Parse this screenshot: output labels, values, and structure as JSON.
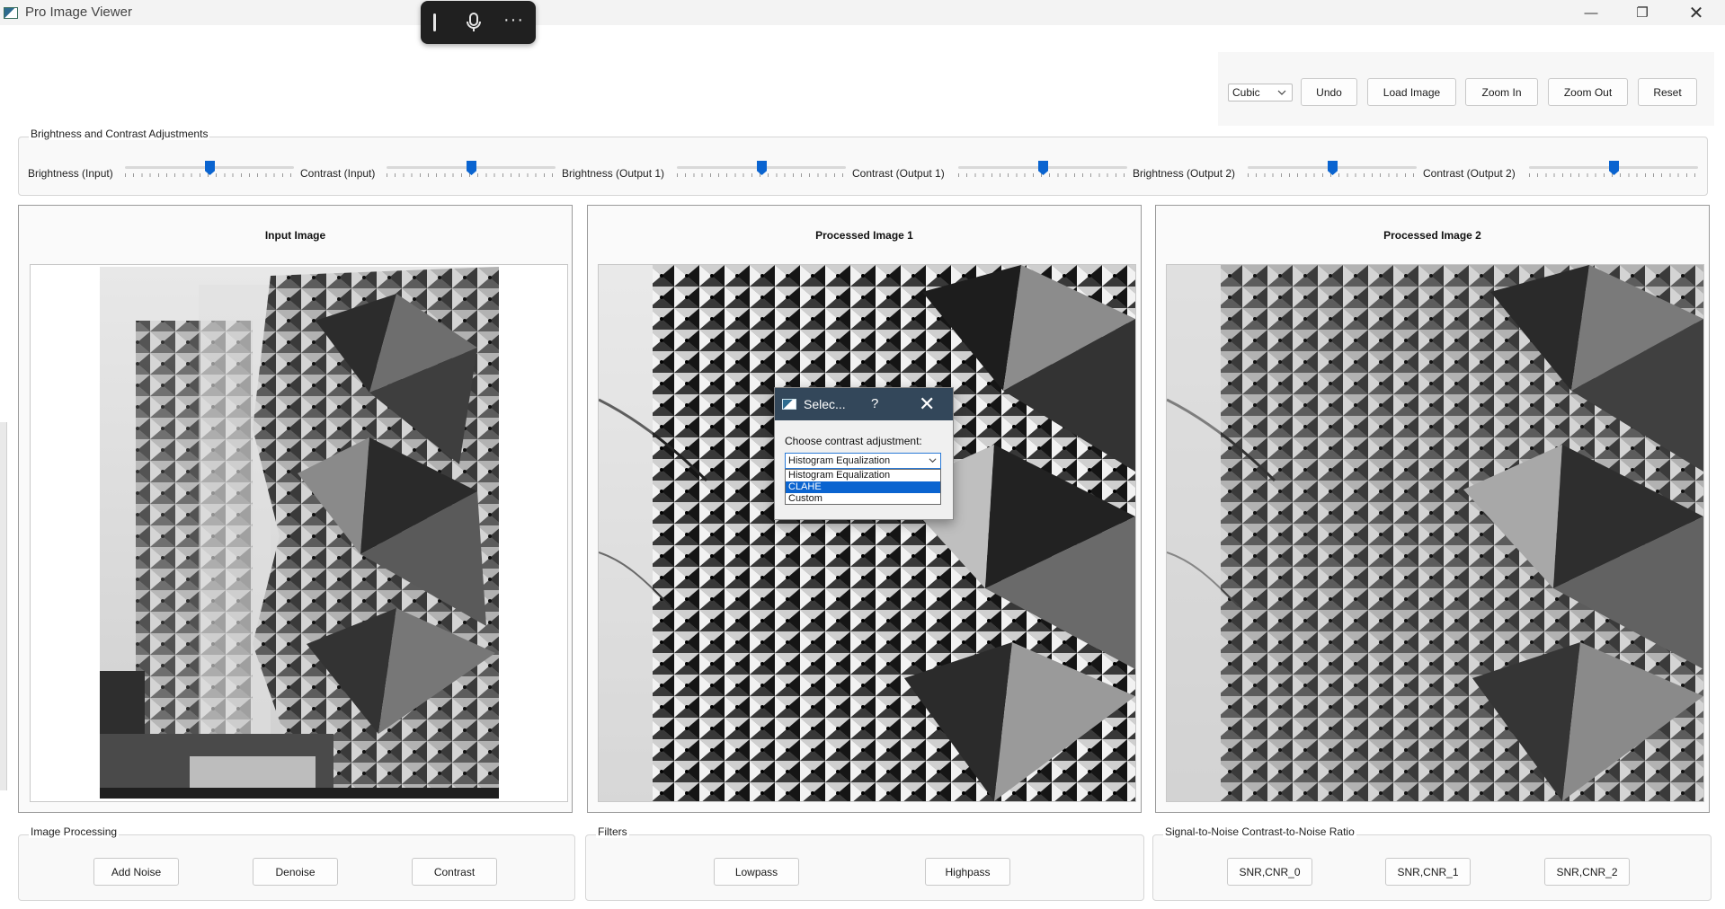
{
  "window": {
    "title": "Pro Image Viewer",
    "minimize": "—",
    "maximize": "❐",
    "close": "✕"
  },
  "voice_toolbar": {
    "more": "···"
  },
  "toolbar": {
    "interpolation": "Cubic",
    "undo": "Undo",
    "load_image": "Load Image",
    "zoom_in": "Zoom In",
    "zoom_out": "Zoom Out",
    "reset": "Reset"
  },
  "adjustments": {
    "title": "Brightness and Contrast Adjustments",
    "sliders": [
      {
        "label": "Brightness (Input)",
        "value": 0.5
      },
      {
        "label": "Contrast (Input)",
        "value": 0.5
      },
      {
        "label": "Brightness (Output 1)",
        "value": 0.5
      },
      {
        "label": "Contrast (Output 1)",
        "value": 0.5
      },
      {
        "label": "Brightness (Output 2)",
        "value": 0.5
      },
      {
        "label": "Contrast (Output 2)",
        "value": 0.5
      }
    ]
  },
  "panels": {
    "input": {
      "title": "Input Image"
    },
    "processed1": {
      "title": "Processed Image 1"
    },
    "processed2": {
      "title": "Processed Image 2"
    }
  },
  "dialog": {
    "title": "Selec...",
    "help": "?",
    "close": "✕",
    "label": "Choose contrast adjustment:",
    "selected": "Histogram Equalization",
    "options": [
      "Histogram Equalization",
      "CLAHE",
      "Custom"
    ],
    "highlighted": "CLAHE"
  },
  "image_processing": {
    "title": "Image Processing",
    "add_noise": "Add Noise",
    "denoise": "Denoise",
    "contrast": "Contrast"
  },
  "filters": {
    "title": "Filters",
    "lowpass": "Lowpass",
    "highpass": "Highpass"
  },
  "snr": {
    "title": "Signal-to-Noise  Contrast-to-Noise Ratio",
    "b0": "SNR,CNR_0",
    "b1": "SNR,CNR_1",
    "b2": "SNR,CNR_2"
  },
  "colors": {
    "accent": "#0a64d0",
    "dialog_titlebar": "#33475a"
  }
}
